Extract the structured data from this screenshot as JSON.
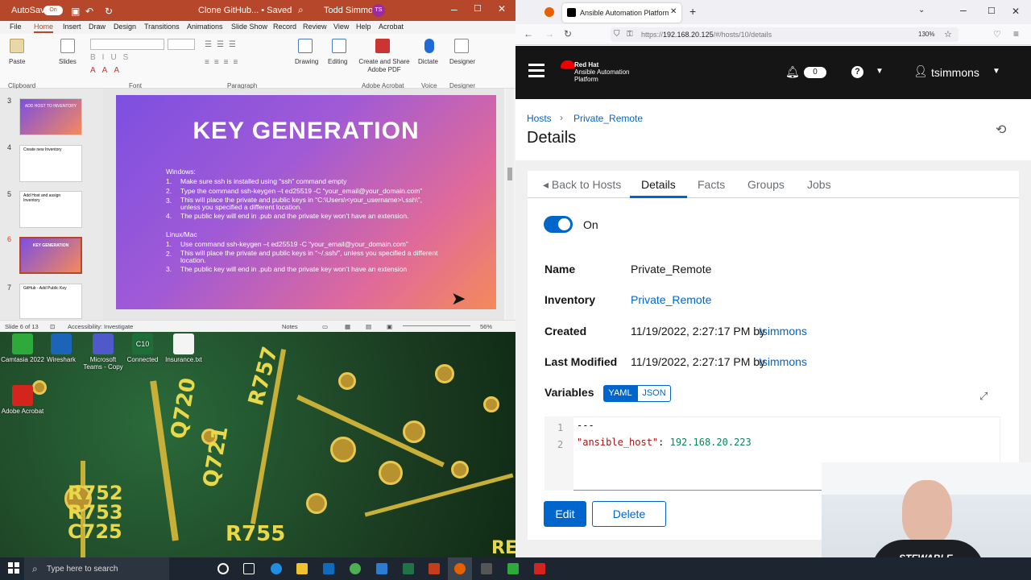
{
  "powerpoint": {
    "autosave": "AutoSave",
    "autosave_state": "On",
    "doc_title": "Clone GitHub... • Saved",
    "user": "Todd Simmons",
    "user_initials": "TS",
    "menu": [
      "File",
      "Home",
      "Insert",
      "Draw",
      "Design",
      "Transitions",
      "Animations",
      "Slide Show",
      "Record",
      "Review",
      "View",
      "Help",
      "Acrobat"
    ],
    "ribbon": {
      "paste": "Paste",
      "slides": "Slides",
      "clipboard": "Clipboard",
      "font": "Font",
      "paragraph": "Paragraph",
      "drawing": "Drawing",
      "editing": "Editing",
      "create_share": "Create and Share Adobe PDF",
      "adobe_acrobat": "Adobe Acrobat",
      "dictate": "Dictate",
      "voice": "Voice",
      "designer": "Designer",
      "designer_group": "Designer"
    },
    "thumbs": [
      {
        "num": "3",
        "title": "ADD HOST TO INVENTORY"
      },
      {
        "num": "4",
        "title": "Create new Inventory"
      },
      {
        "num": "5",
        "title": "Add Host and assign Inventory"
      },
      {
        "num": "6",
        "title": "KEY GENERATION"
      },
      {
        "num": "7",
        "title": "GitHub - Add Public Key"
      }
    ],
    "slide": {
      "title": "KEY GENERATION",
      "win_header": "Windows:",
      "win_items": [
        {
          "n": "1.",
          "t": "Make sure ssh is installed using “ssh” command empty"
        },
        {
          "n": "2.",
          "t": "Type the command ssh-keygen –t ed25519 -C “your_email@your_domain.com”"
        },
        {
          "n": "3.",
          "t": "This will place the private and public keys in “C:\\Users\\<your_username>\\.ssh\\”, unless you specified a different location."
        },
        {
          "n": "4.",
          "t": "The public key will end in .pub and the private key won’t have an extension."
        }
      ],
      "lin_header": "Linux/Mac",
      "lin_items": [
        {
          "n": "1.",
          "t": "Use command ssh-keygen –t ed25519 -C “your_email@your_domain.com”"
        },
        {
          "n": "2.",
          "t": "This will place the private and public keys in “~/.ssh/”, unless you specified a different location."
        },
        {
          "n": "3.",
          "t": "The public key will end in .pub and the private key won’t have an extension"
        }
      ]
    },
    "status": {
      "slide": "Slide 6 of 13",
      "accessibility": "Accessibility: Investigate",
      "notes": "Notes",
      "zoom": "56%"
    }
  },
  "desktop": {
    "icons": [
      {
        "label": "Camtasia 2022",
        "color": "#2eaa3a"
      },
      {
        "label": "Wireshark",
        "color": "#1c64b8"
      },
      {
        "label": "Microsoft Teams - Copy",
        "color": "#5059c9"
      },
      {
        "label": "Connected",
        "color": "#1e6e3a"
      },
      {
        "label": "Insurance.txt",
        "color": "#f4f4f4"
      },
      {
        "label": "Adobe Acrobat",
        "color": "#d3251e"
      }
    ],
    "icon_c10": "C10",
    "silk": [
      "R757",
      "Q720",
      "Q721",
      "R752",
      "R753",
      "C725",
      "R755",
      "RE"
    ]
  },
  "browser": {
    "tab_title": "Ansible Automation Platform | ...",
    "url_prefix": "https://",
    "url_host": "192.168.20.125",
    "url_path": "/#/hosts/10/details",
    "zoom": "130%",
    "app": {
      "brand_line1": "Red Hat",
      "brand_line2": "Ansible Automation",
      "brand_line3": "Platform",
      "notif_count": "0",
      "username": "tsimmons"
    },
    "breadcrumb": {
      "hosts": "Hosts",
      "current": "Private_Remote"
    },
    "page_title": "Details",
    "tabs": {
      "back": "Back to Hosts",
      "details": "Details",
      "facts": "Facts",
      "groups": "Groups",
      "jobs": "Jobs"
    },
    "toggle_label": "On",
    "fields": {
      "name_label": "Name",
      "name_value": "Private_Remote",
      "inventory_label": "Inventory",
      "inventory_value": "Private_Remote",
      "created_label": "Created",
      "created_value": "11/19/2022, 2:27:17 PM by",
      "created_user": "tsimmons",
      "modified_label": "Last Modified",
      "modified_value": "11/19/2022, 2:27:17 PM by",
      "modified_user": "tsimmons",
      "variables_label": "Variables",
      "yaml": "YAML",
      "json": "JSON"
    },
    "code": {
      "line1_num": "1",
      "line1": "---",
      "line2_num": "2",
      "line2_key": "\"ansible_host\"",
      "line2_colon": ": ",
      "line2_val": "192.168.20.223"
    },
    "buttons": {
      "edit": "Edit",
      "delete": "Delete"
    }
  },
  "webcam": {
    "shirt_text": "STEWABLE"
  },
  "taskbar": {
    "search_placeholder": "Type here to search"
  },
  "colors": {
    "ppt": "#b7472a",
    "aap_header": "#151515",
    "link": "#0066cc",
    "primary": "#0066cc"
  }
}
